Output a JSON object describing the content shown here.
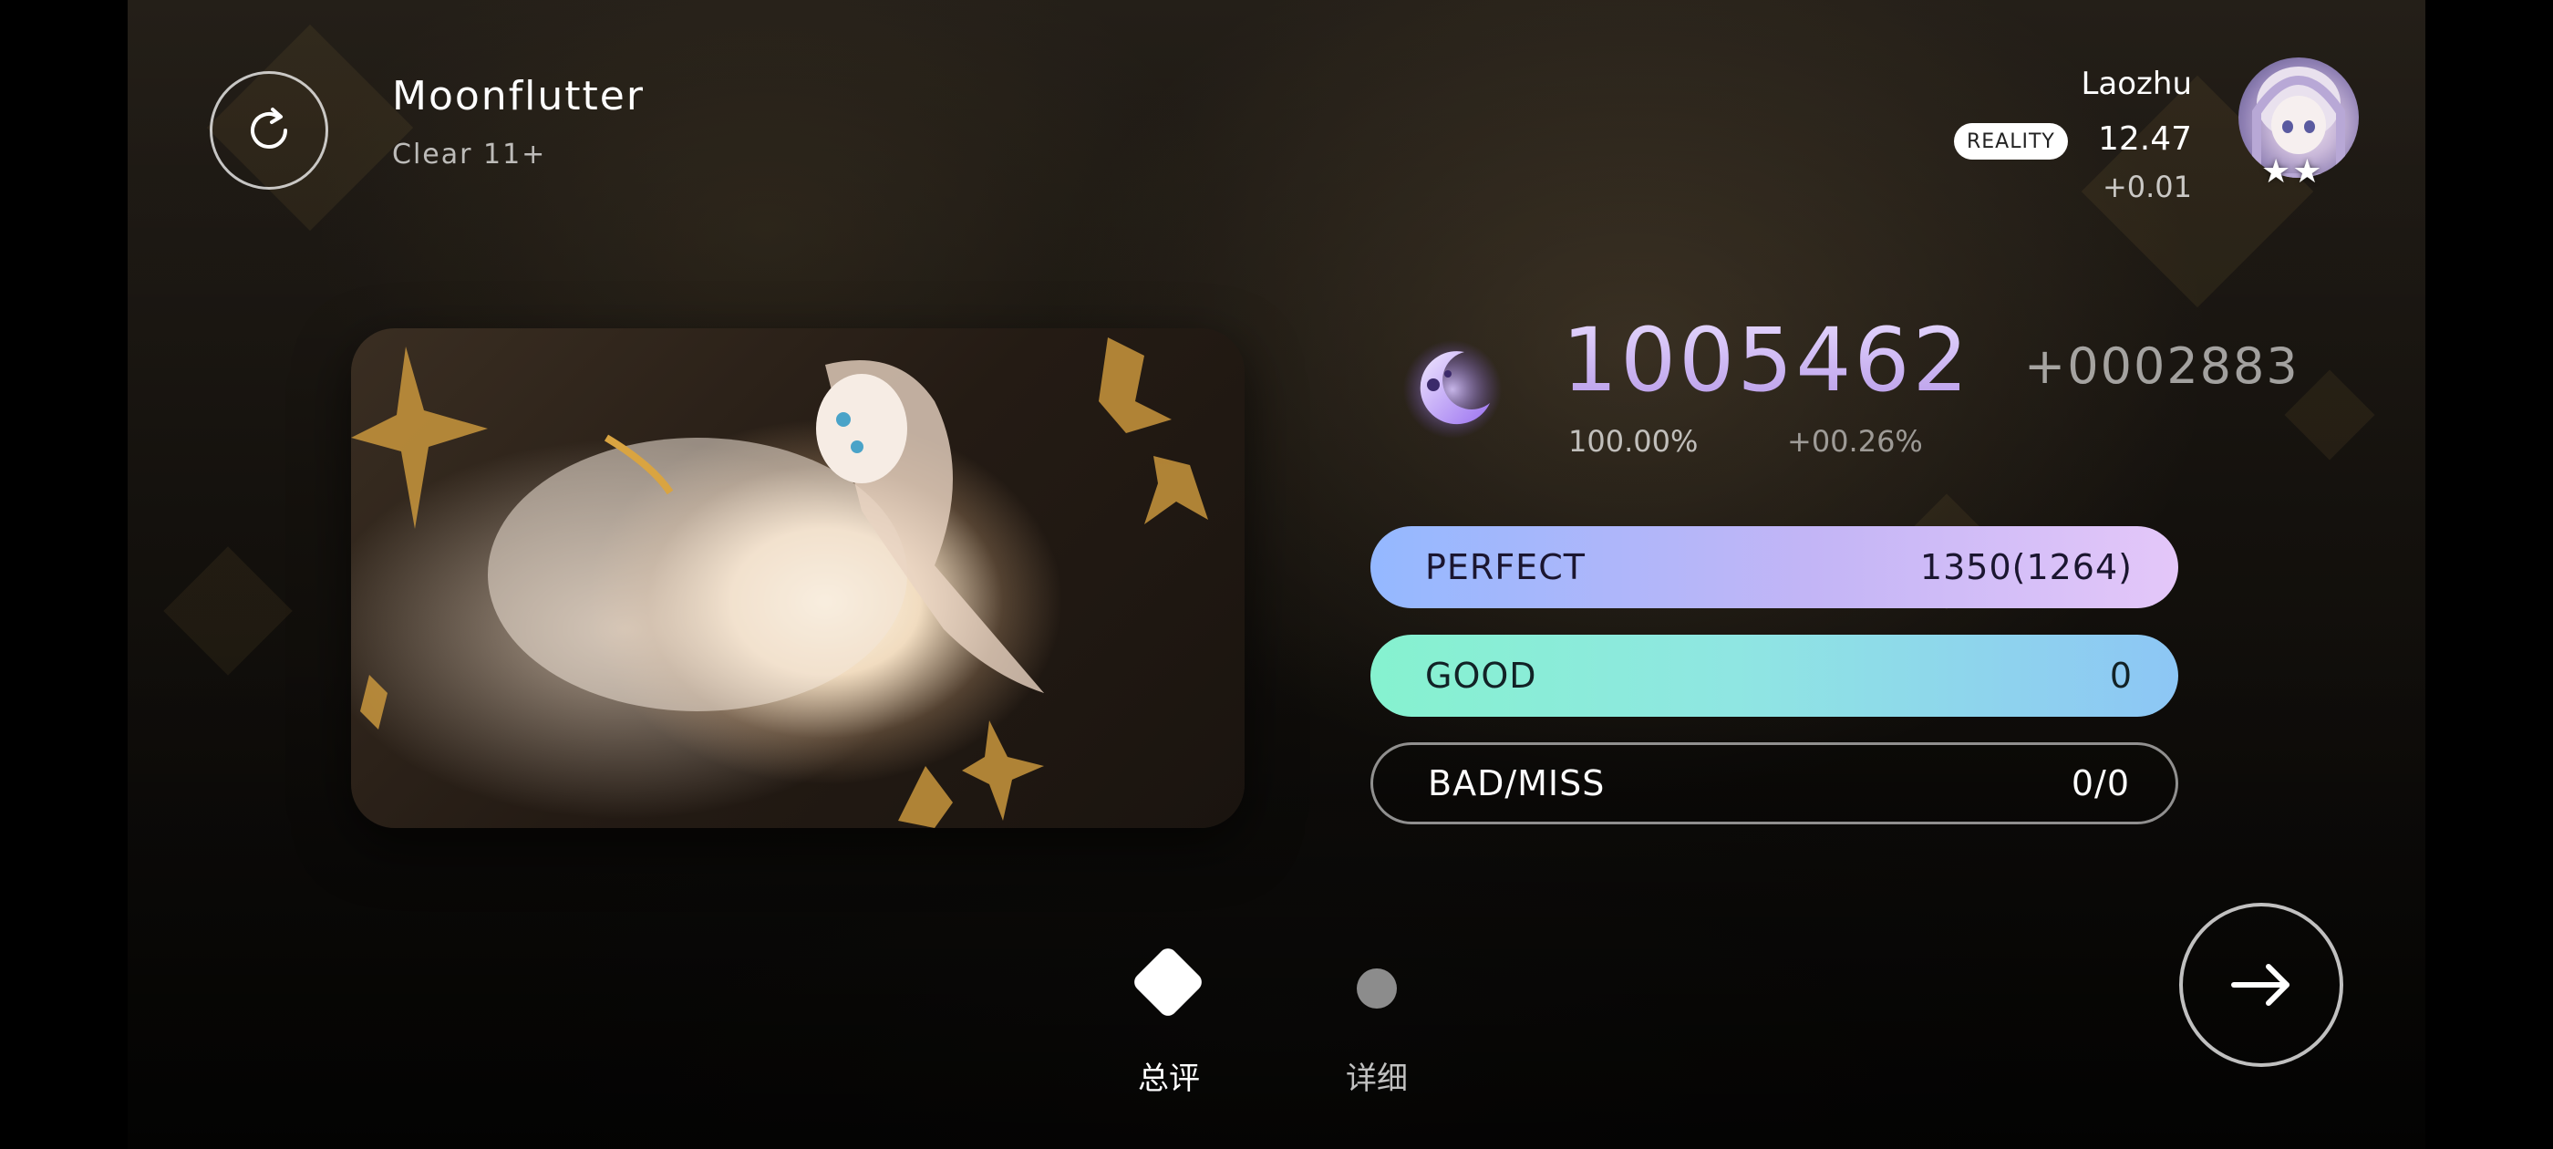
{
  "song": {
    "title": "Moonflutter",
    "difficulty": "Clear 11+"
  },
  "player": {
    "name": "Laozhu",
    "badge": "REALITY",
    "rating": "12.47",
    "rating_delta": "+0.01",
    "avatar_stars": "★★"
  },
  "result": {
    "score": "1005462",
    "score_delta": "+0002883",
    "accuracy": "100.00%",
    "accuracy_delta": "+00.26%"
  },
  "judgements": {
    "perfect": {
      "label": "PERFECT",
      "value": "1350(1264)"
    },
    "good": {
      "label": "GOOD",
      "value": "0"
    },
    "bad_miss": {
      "label": "BAD/MISS",
      "value": "0/0"
    }
  },
  "tabs": {
    "overview": "总评",
    "details": "详细"
  },
  "icons": {
    "retry": "refresh-icon",
    "grade": "moon-grade-icon",
    "next": "arrow-right-icon"
  },
  "colors": {
    "score": "#c9b3f0",
    "perfect_bar_start": "#94b8ff",
    "perfect_bar_end": "#e4c7f9",
    "good_bar_start": "#86f2cf",
    "good_bar_end": "#8dc6f5"
  }
}
